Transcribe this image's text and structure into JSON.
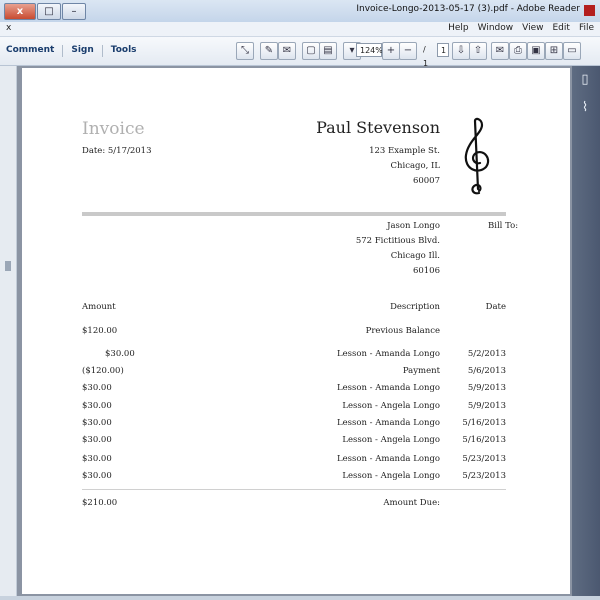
{
  "window": {
    "title": "Invoice-Longo-2013-05-17 (3).pdf - Adobe Reader",
    "controls": {
      "minimize": "–",
      "maximize": "□",
      "close": "x"
    }
  },
  "menubar": {
    "close_doc": "x",
    "items": [
      "File",
      "Edit",
      "View",
      "Window",
      "Help"
    ]
  },
  "toolbar": {
    "links": {
      "comment": "Comment",
      "sign": "Sign",
      "tools": "Tools"
    },
    "zoom": "124%",
    "page_total": "/ 1",
    "page_current": "1"
  },
  "invoice": {
    "heading": "Invoice",
    "date": "Date: 5/17/2013",
    "from": {
      "name": "Paul Stevenson",
      "street": "123 Example St.",
      "city": "Chicago, IL",
      "zip": "60007"
    },
    "bill_to_label": "Bill To:",
    "bill_to": {
      "name": "Jason Longo",
      "street": "572 Fictitious Blvd.",
      "city": "Chicago Ill.",
      "zip": "60106"
    },
    "columns": {
      "amount": "Amount",
      "description": "Description",
      "date": "Date"
    },
    "previous_balance": {
      "amount": "$120.00",
      "description": "Previous Balance"
    },
    "rows": [
      {
        "amount": "$30.00",
        "description": "Lesson - Amanda Longo",
        "date": "5/2/2013"
      },
      {
        "amount": "($120.00)",
        "description": "Payment",
        "date": "5/6/2013"
      },
      {
        "amount": "$30.00",
        "description": "Lesson - Amanda Longo",
        "date": "5/9/2013"
      },
      {
        "amount": "$30.00",
        "description": "Lesson - Angela Longo",
        "date": "5/9/2013"
      },
      {
        "amount": "$30.00",
        "description": "Lesson - Amanda Longo",
        "date": "5/16/2013"
      },
      {
        "amount": "$30.00",
        "description": "Lesson - Angela Longo",
        "date": "5/16/2013"
      },
      {
        "amount": "$30.00",
        "description": "Lesson - Amanda Longo",
        "date": "5/23/2013"
      },
      {
        "amount": "$30.00",
        "description": "Lesson - Angela Longo",
        "date": "5/23/2013"
      }
    ],
    "amount_due_label": "Amount Due:",
    "amount_due": "$210.00"
  },
  "icons": {
    "logo": "treble-clef-icon",
    "pages_panel": "pages-icon",
    "attachments_panel": "paperclip-icon"
  }
}
